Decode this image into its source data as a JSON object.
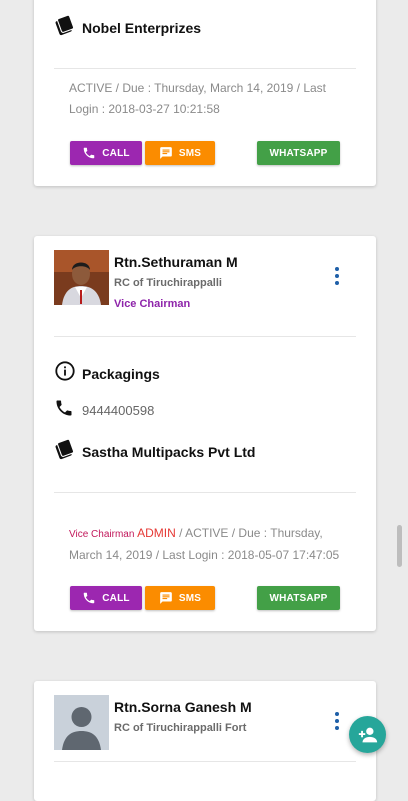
{
  "cards": [
    {
      "company": "Nobel Enterprizes",
      "status": "ACTIVE / Due : Thursday, March 14, 2019 / Last Login : 2018-03-27 10:21:58",
      "buttons": {
        "call": "CALL",
        "sms": "SMS",
        "whatsapp": "WHATSAPP"
      }
    },
    {
      "name": "Rtn.Sethuraman M",
      "club": "RC of Tiruchirappalli",
      "designation": "Vice Chairman",
      "business": "Packagings",
      "phone": "9444400598",
      "company": "Sastha Multipacks Pvt Ltd",
      "status_role": "Vice Chairman",
      "status_admin": "ADMIN",
      "status": " / ACTIVE / Due : Thursday, March 14, 2019 / Last Login : 2018-05-07 17:47:05",
      "buttons": {
        "call": "CALL",
        "sms": "SMS",
        "whatsapp": "WHATSAPP"
      }
    },
    {
      "name": "Rtn.Sorna Ganesh M",
      "club": "RC of Tiruchirappalli Fort"
    }
  ],
  "colors": {
    "call": "#9c27b0",
    "sms": "#fb8c00",
    "whatsapp": "#43a047",
    "designation": "#8e24aa",
    "admin": "#e53935",
    "fab": "#26a69a",
    "menu_dots": "#1e5fa8"
  },
  "icons": {
    "company": "id-card-icon",
    "info": "info-icon",
    "phone": "phone-icon",
    "call": "phone-icon",
    "sms": "message-icon",
    "fab": "add-person-icon"
  }
}
